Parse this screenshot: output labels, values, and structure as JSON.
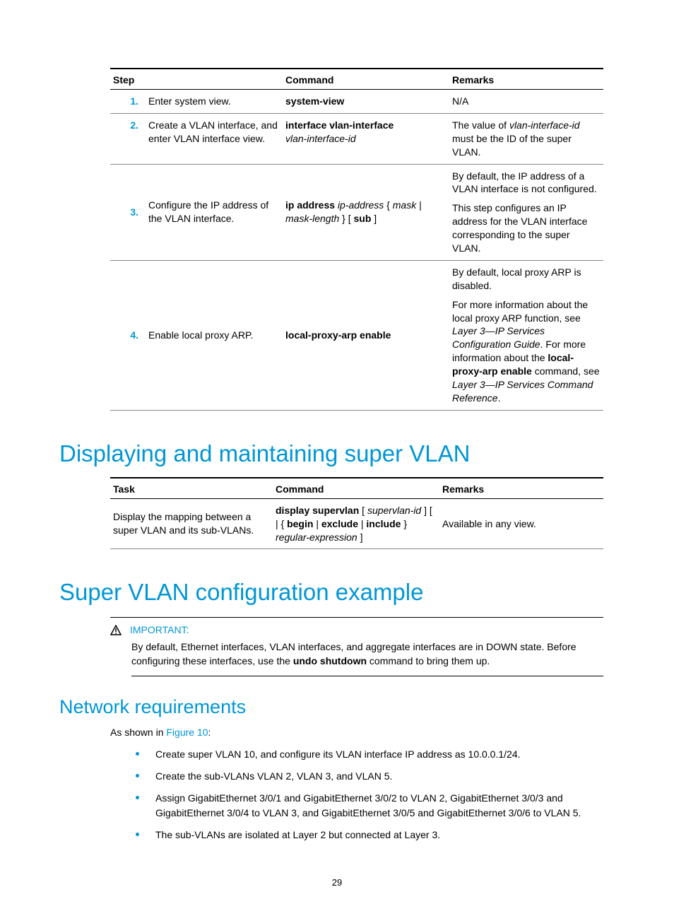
{
  "table1": {
    "headers": {
      "step": "Step",
      "cmd": "Command",
      "rem": "Remarks"
    },
    "rows": [
      {
        "num": "1.",
        "task": "Enter system view.",
        "cmd_bold1": "system-view",
        "rem": "N/A"
      },
      {
        "num": "2.",
        "task": "Create a VLAN interface, and enter VLAN interface view.",
        "cmd_bold1": "interface vlan-interface",
        "cmd_ital1": "vlan-interface-id",
        "rem_pre": "The value of ",
        "rem_ital": "vlan-interface-id",
        "rem_post": " must be the ID of the super VLAN."
      },
      {
        "num": "3.",
        "task": "Configure the IP address of the VLAN interface.",
        "cmd_bold1": "ip address",
        "cmd_ital1": "ip-address",
        "cmd_plain1": " { ",
        "cmd_ital2": "mask",
        "cmd_plain2": " | ",
        "cmd_ital3": "mask-length",
        "cmd_plain3": " } [ ",
        "cmd_bold2": "sub",
        "cmd_plain4": " ]",
        "rem1": "By default, the IP address of a VLAN interface is not configured.",
        "rem2": "This step configures an IP address for the VLAN interface corresponding to the super VLAN."
      },
      {
        "num": "4.",
        "task": "Enable local proxy ARP.",
        "cmd_bold1": "local-proxy-arp enable",
        "rem1": "By default, local proxy ARP is disabled.",
        "rem2_pre": "For more information about the local proxy ARP function, see ",
        "rem2_ital1": "Layer 3—IP Services Configuration Guide",
        "rem2_mid": ". For more information about the ",
        "rem2_bold": "local-proxy-arp enable",
        "rem2_mid2": " command, see ",
        "rem2_ital2": "Layer 3—IP Services Command Reference",
        "rem2_end": "."
      }
    ]
  },
  "h1_1": "Displaying and maintaining super VLAN",
  "table2": {
    "headers": {
      "task": "Task",
      "cmd": "Command",
      "rem": "Remarks"
    },
    "row": {
      "task": "Display the mapping between a super VLAN and its sub-VLANs.",
      "c1": "display supervlan",
      "c2": " [ ",
      "c3": "supervlan-id",
      "c4": " ] [ | { ",
      "c5": "begin",
      "c6": " | ",
      "c7": "exclude",
      "c8": " | ",
      "c9": "include",
      "c10": " } ",
      "c11": "regular-expression",
      "c12": " ]",
      "rem": "Available in any view."
    }
  },
  "h1_2": "Super VLAN configuration example",
  "important": {
    "title": "IMPORTANT:",
    "body_pre": "By default, Ethernet interfaces, VLAN interfaces, and aggregate interfaces are in DOWN state. Before configuring these interfaces, use the ",
    "body_bold": "undo shutdown",
    "body_post": " command to bring them up."
  },
  "h2_1": "Network requirements",
  "para1_pre": "As shown in ",
  "para1_link": "Figure 10",
  "para1_post": ":",
  "reqs": [
    "Create super VLAN 10, and configure its VLAN interface IP address as 10.0.0.1/24.",
    "Create the sub-VLANs VLAN 2, VLAN 3, and VLAN 5.",
    "Assign GigabitEthernet 3/0/1 and GigabitEthernet 3/0/2 to VLAN 2, GigabitEthernet 3/0/3 and GigabitEthernet 3/0/4 to VLAN 3, and GigabitEthernet 3/0/5 and GigabitEthernet 3/0/6 to VLAN 5.",
    "The sub-VLANs are isolated at Layer 2 but connected at Layer 3."
  ],
  "page_num": "29"
}
